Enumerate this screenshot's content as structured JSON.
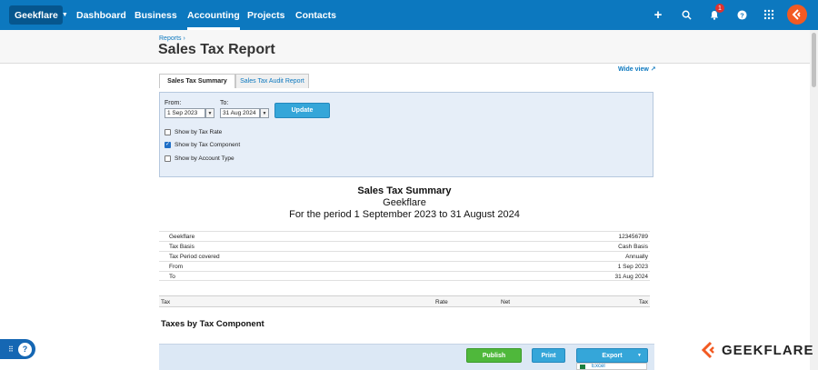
{
  "topnav": {
    "org": "Geekflare",
    "links": [
      "Dashboard",
      "Business",
      "Accounting",
      "Projects",
      "Contacts"
    ],
    "active": "Accounting",
    "notification_count": "1",
    "icons": [
      "plus-icon",
      "search-icon",
      "bell-icon",
      "help-icon",
      "apps-grid-icon",
      "geekflare-logo-icon"
    ],
    "colors": {
      "bar": "#0c78bf",
      "org_button": "#06568e",
      "badge": "#e0322f",
      "logo": "#f25a22"
    }
  },
  "header": {
    "breadcrumb": "Reports ›",
    "title": "Sales Tax Report",
    "wide_view": "Wide view ↗"
  },
  "tabs": [
    "Sales Tax Summary",
    "Sales Tax Audit Report"
  ],
  "filters": {
    "from_label": "From:",
    "to_label": "To:",
    "from_value": "1 Sep 2023",
    "to_value": "31 Aug 2024",
    "update_label": "Update",
    "options": [
      {
        "label": "Show by Tax Rate",
        "checked": false
      },
      {
        "label": "Show by Tax Component",
        "checked": true
      },
      {
        "label": "Show by Account Type",
        "checked": false
      }
    ]
  },
  "report": {
    "title": "Sales Tax Summary",
    "org": "Geekflare",
    "period": "For the period 1 September 2023 to 31 August 2024",
    "info": [
      {
        "key": "Geekflare",
        "value": "123456789"
      },
      {
        "key": "Tax Basis",
        "value": "Cash Basis"
      },
      {
        "key": "Tax Period covered",
        "value": "Annually"
      },
      {
        "key": "From",
        "value": "1 Sep 2023"
      },
      {
        "key": "To",
        "value": "31 Aug 2024"
      }
    ],
    "columns": [
      "Tax",
      "Rate",
      "Net",
      "Tax"
    ],
    "section": "Taxes by Tax Component"
  },
  "actions": {
    "publish": "Publish",
    "print": "Print",
    "export": "Export",
    "export_menu_first": "Excel"
  },
  "watermark": {
    "text": "GEEKFLARE",
    "color": "#f25a22"
  }
}
